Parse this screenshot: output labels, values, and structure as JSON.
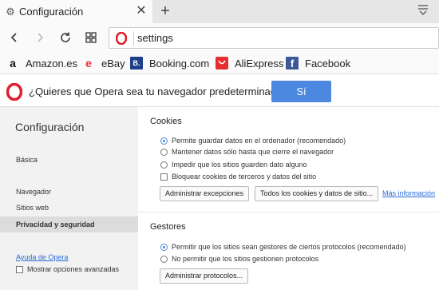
{
  "tab": {
    "title": "Configuración",
    "icon": "gear-icon"
  },
  "address": {
    "url": "settings"
  },
  "bookmarks": [
    {
      "label": "Amazon.es",
      "icon_char": "a"
    },
    {
      "label": "eBay",
      "icon_char": "e"
    },
    {
      "label": "Booking.com",
      "icon_char": "B."
    },
    {
      "label": "AliExpress",
      "icon_char": ""
    },
    {
      "label": "Facebook",
      "icon_char": "f"
    }
  ],
  "default_bar": {
    "question": "¿Quieres que Opera sea tu navegador predeterminado?",
    "yes_label": "Sí"
  },
  "sidebar": {
    "title": "Configuración",
    "items": [
      {
        "label": "Básica"
      },
      {
        "label": "Navegador"
      },
      {
        "label": "Sitios web"
      },
      {
        "label": "Privacidad y seguridad"
      }
    ],
    "help_link": "Ayuda de Opera",
    "advanced_label": "Mostrar opciones avanzadas"
  },
  "cookies": {
    "title": "Cookies",
    "options": [
      "Permite guardar datos en el ordenador (recomendado)",
      "Mantener datos sólo hasta que cierre el navegador",
      "Impedir que los sitios guarden dato alguno",
      "Bloquear cookies de terceros y datos del sitio"
    ],
    "manage_exceptions": "Administrar excepciones",
    "all_cookies": "Todos los cookies y datos de sitio...",
    "more_info": "Más información"
  },
  "handlers": {
    "title": "Gestores",
    "options": [
      "Permitir que los sitios sean gestores de ciertos protocolos (recomendado)",
      "No permitir que los sitios gestionen protocolos"
    ],
    "manage_protocols": "Administrar protocolos..."
  },
  "colors": {
    "accent": "#4c87e0",
    "opera_red": "#e0212f",
    "link": "#2a6ad6"
  }
}
